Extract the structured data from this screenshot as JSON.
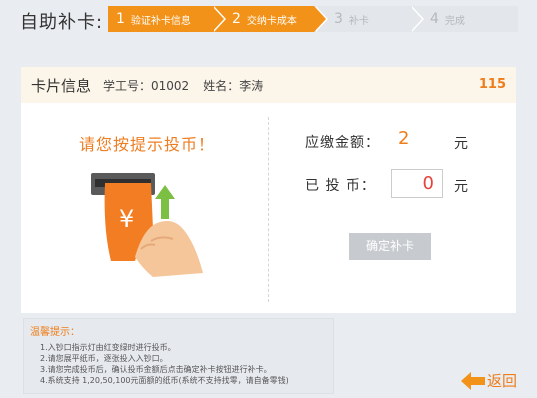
{
  "header": {
    "title": "自助补卡:",
    "steps": [
      {
        "num": "1",
        "label": "验证补卡信息",
        "state": "active"
      },
      {
        "num": "2",
        "label": "交纳卡成本",
        "state": "active"
      },
      {
        "num": "3",
        "label": "补卡",
        "state": "inactive"
      },
      {
        "num": "4",
        "label": "完成",
        "state": "inactive"
      }
    ]
  },
  "card": {
    "title": "卡片信息",
    "id_text": "学工号：01002",
    "name_text": "姓名：李涛",
    "count": "115"
  },
  "payment": {
    "prompt": "请您按提示投币！",
    "due_label": "应缴金额：",
    "due_value": "2",
    "due_unit": "元",
    "inserted_label": "已 投 币：",
    "inserted_value": "0",
    "inserted_unit": "元",
    "confirm_label": "确定补卡"
  },
  "tips": {
    "title": "温馨提示：",
    "lines": [
      "1.入钞口指示灯由红变绿时进行投币。",
      "2.请您展平纸币，逐张投入入钞口。",
      "3.请您完成投币后，确认投币金额后点击确定补卡按钮进行补卡。",
      "4.系统支持 1,20,50,100元面额的纸币(系统不支持找零，请自备零钱)"
    ]
  },
  "back_label": "返回",
  "colors": {
    "accent": "#f39218",
    "text_orange": "#ee7d1a",
    "bg": "#e9ecf0"
  }
}
